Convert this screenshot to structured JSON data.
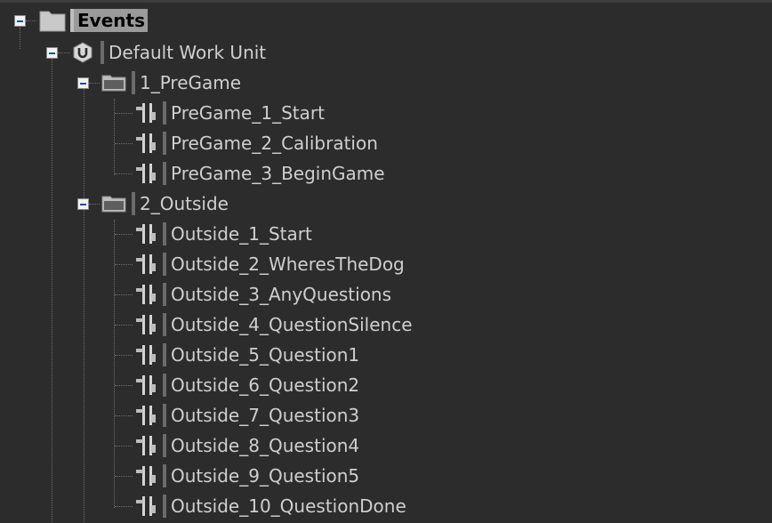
{
  "tree": {
    "root": {
      "label": "Events",
      "icon": "folder-icon",
      "children": [
        {
          "label": "Default Work Unit",
          "icon": "work-unit-icon",
          "children": [
            {
              "label": "1_PreGame",
              "icon": "folder-icon",
              "children": [
                {
                  "label": "PreGame_1_Start",
                  "icon": "event-icon"
                },
                {
                  "label": "PreGame_2_Calibration",
                  "icon": "event-icon"
                },
                {
                  "label": "PreGame_3_BeginGame",
                  "icon": "event-icon"
                }
              ]
            },
            {
              "label": "2_Outside",
              "icon": "folder-icon",
              "children": [
                {
                  "label": "Outside_1_Start",
                  "icon": "event-icon"
                },
                {
                  "label": "Outside_2_WheresTheDog",
                  "icon": "event-icon"
                },
                {
                  "label": "Outside_3_AnyQuestions",
                  "icon": "event-icon"
                },
                {
                  "label": "Outside_4_QuestionSilence",
                  "icon": "event-icon"
                },
                {
                  "label": "Outside_5_Question1",
                  "icon": "event-icon"
                },
                {
                  "label": "Outside_6_Question2",
                  "icon": "event-icon"
                },
                {
                  "label": "Outside_7_Question3",
                  "icon": "event-icon"
                },
                {
                  "label": "Outside_8_Question4",
                  "icon": "event-icon"
                },
                {
                  "label": "Outside_9_Question5",
                  "icon": "event-icon"
                },
                {
                  "label": "Outside_10_QuestionDone",
                  "icon": "event-icon"
                }
              ]
            }
          ]
        }
      ]
    }
  }
}
